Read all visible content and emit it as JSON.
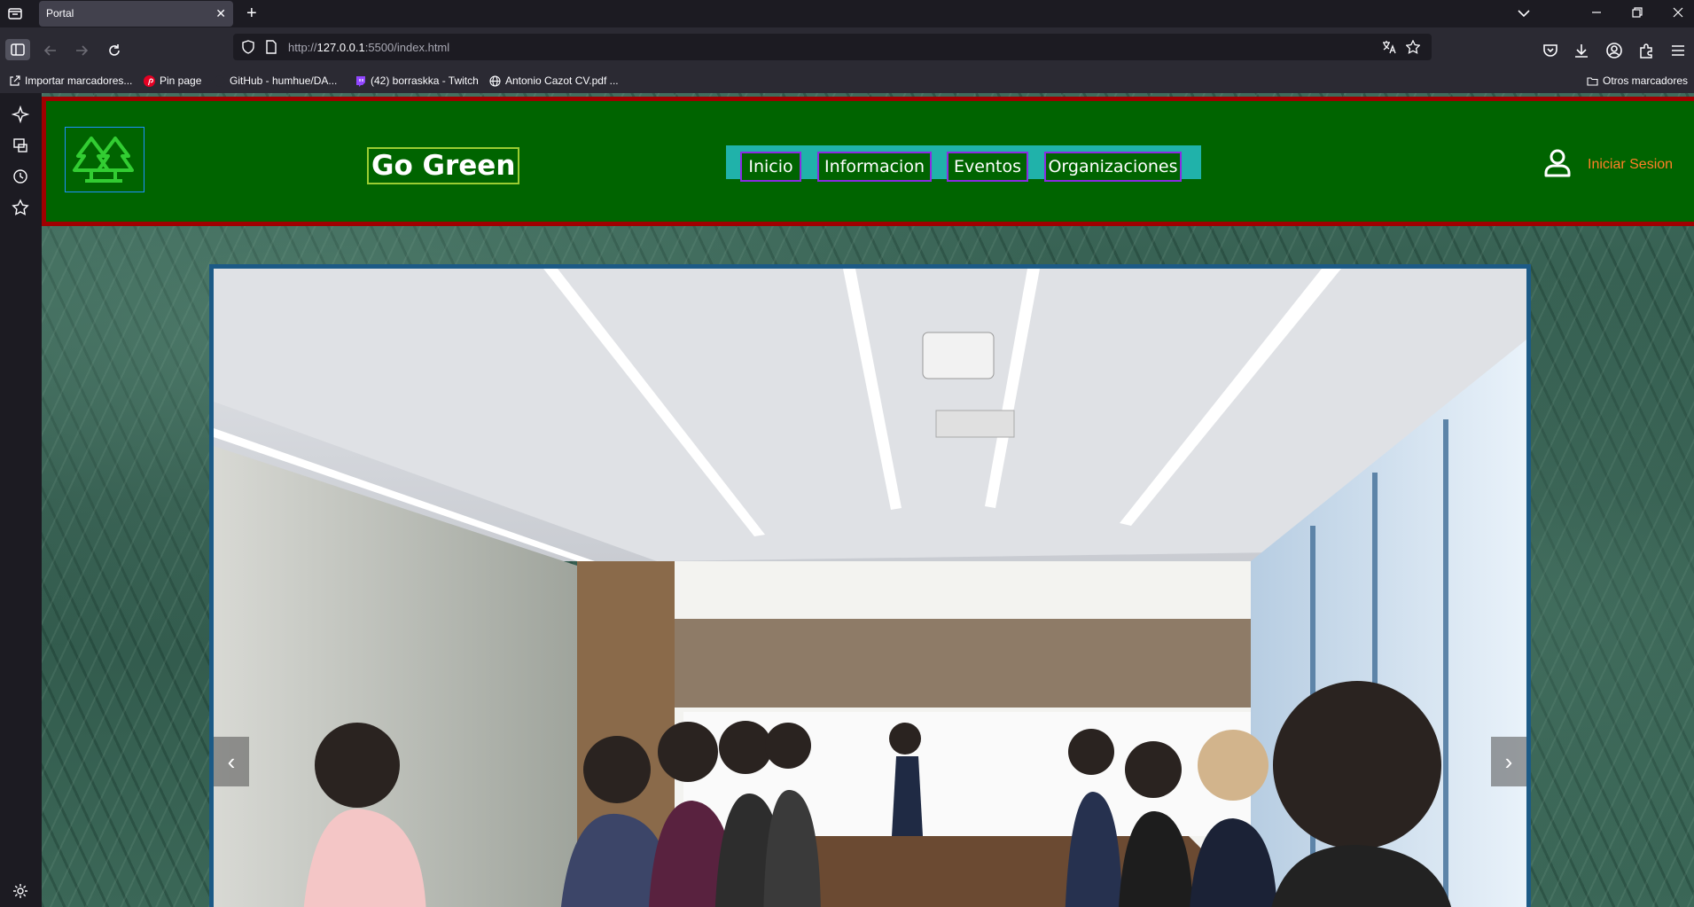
{
  "browser": {
    "tab_title": "Portal",
    "tab_close_glyph": "✕",
    "new_tab_glyph": "+",
    "url_prefix": "http://",
    "url_host": "127.0.0.1",
    "url_rest": ":5500/index.html",
    "bookmarks": [
      {
        "label": "Importar marcadores...",
        "icon": "import-icon"
      },
      {
        "label": "Pin page",
        "icon": "pinterest-icon"
      },
      {
        "label": "GitHub - humhue/DA...",
        "icon": "github-icon"
      },
      {
        "label": "(42) borraskka - Twitch",
        "icon": "twitch-icon"
      },
      {
        "label": "Antonio Cazot CV.pdf ...",
        "icon": "globe-icon"
      }
    ],
    "other_bookmarks": "Otros marcadores"
  },
  "site": {
    "brand": "Go Green",
    "nav": [
      "Inicio",
      "Informacion",
      "Eventos",
      "Organizaciones"
    ],
    "login": "Iniciar Sesion",
    "carousel": {
      "prev_glyph": "‹",
      "next_glyph": "›"
    }
  },
  "colors": {
    "header_bg": "#006400",
    "header_border": "#a00000",
    "nav_bg": "#20b2aa",
    "nav_link_border": "#8a2be2",
    "brand_border": "#9acd32",
    "login_color": "#ff7f27",
    "logo_green": "#32cd32",
    "carousel_border": "#1c5a86"
  }
}
